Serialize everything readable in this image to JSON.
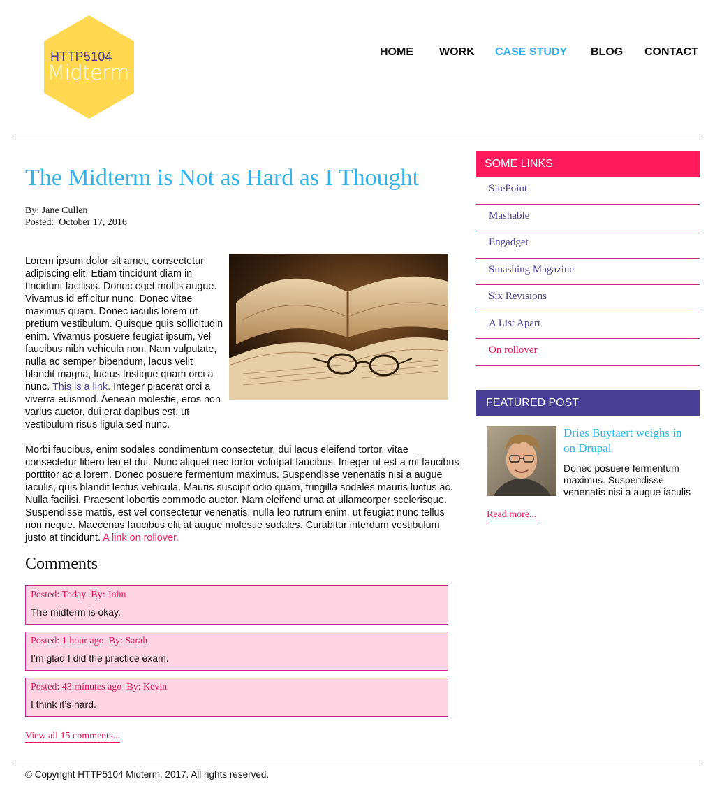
{
  "logo": {
    "line1": "HTTP5104",
    "line2": "Midterm",
    "color": "#ffd84f"
  },
  "nav": {
    "items": [
      {
        "label": "HOME"
      },
      {
        "label": "WORK"
      },
      {
        "label": "CASE STUDY",
        "active": true
      },
      {
        "label": "BLOG"
      },
      {
        "label": "CONTACT"
      }
    ]
  },
  "article": {
    "title": "The Midterm is Not as Hard as I Thought",
    "author": "By: Jane Cullen",
    "posted": "Posted:  October 17, 2016",
    "p1_before_link": "Lorem ipsum dolor sit amet, consectetur adipiscing elit. Etiam tincidunt diam in tincidunt facilisis. Donec eget mollis augue. Vivamus id efficitur nunc. Donec vitae maximus quam. Donec iaculis lorem ut pretium vestibulum. Quisque quis sollicitudin enim. Vivamus posuere feugiat ipsum, vel faucibus nibh vehicula non. Nam vulputate, nulla ac semper bibendum, lacus velit blandit magna, luctus tristique quam orci a nunc. ",
    "p1_link": "This is a link.",
    "p1_after_link": " Integer placerat orci a viverra euismod. Aenean molestie, eros non varius auctor, dui erat dapibus est, ut vestibulum risus ligula sed nunc.",
    "p2_text": "Morbi faucibus, enim sodales condimentum consectetur, dui lacus eleifend tortor, vitae consectetur libero leo et dui. Nunc aliquet nec tortor volutpat faucibus. Integer ut est a mi faucibus porttitor ac a lorem. Donec posuere fermentum maximus. Suspendisse venenatis nisi a augue iaculis, quis blandit lectus vehicula. Mauris suscipit odio quam, fringilla sodales mauris luctus ac. Nulla facilisi. Praesent lobortis commodo auctor. Nam eleifend urna at ullamcorper scelerisque. Suspendisse mattis, est vel consectetur venenatis, nulla leo rutrum enim, ut feugiat nunc tellus non neque. Maecenas faucibus elit at augue molestie sodales. Curabitur interdum vestibulum justo at tincidunt. ",
    "p2_link": "A link on rollover."
  },
  "comments": {
    "title": "Comments",
    "items": [
      {
        "meta": "Posted: Today  By: John",
        "text": "The midterm is okay."
      },
      {
        "meta": "Posted: 1 hour ago  By: Sarah",
        "text": "I’m glad I did the practice exam."
      },
      {
        "meta": "Posted: 43 minutes ago  By: Kevin",
        "text": "I think it’s hard."
      }
    ],
    "view_all": "View all 15 comments..."
  },
  "sidebar": {
    "links_title": "SOME LINKS",
    "links": [
      {
        "label": "SitePoint"
      },
      {
        "label": "Mashable"
      },
      {
        "label": "Engadget"
      },
      {
        "label": "Smashing Magazine"
      },
      {
        "label": "Six Revisions"
      },
      {
        "label": "A List Apart"
      },
      {
        "label": "On rollover"
      }
    ],
    "featured_title": "FEATURED POST",
    "featured": {
      "title": "Dries Buytaert weighs in on Drupal",
      "text": "Donec posuere fermentum maximus. Suspendisse venenatis nisi a augue iaculis",
      "read_more": "Read more..."
    }
  },
  "footer": {
    "text": "© Copyright HTTP5104 Midterm, 2017. All rights reserved."
  },
  "colors": {
    "accent_blue": "#33b2ea",
    "accent_pink": "#ff1a5e",
    "accent_purple": "#4a3f96",
    "comment_bg": "#ffd4e2"
  }
}
